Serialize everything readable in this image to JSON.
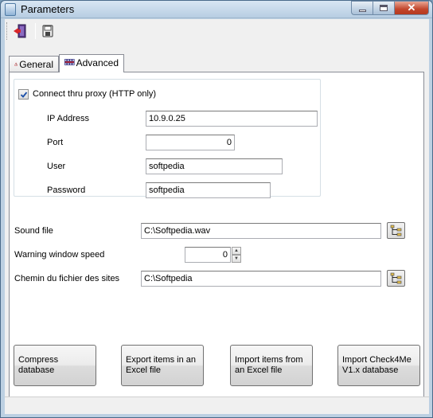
{
  "window": {
    "title": "Parameters",
    "close_glyph": "✕"
  },
  "toolbar": {
    "items": [
      {
        "icon": "exit-door-icon"
      },
      {
        "icon": "save-disk-icon"
      }
    ]
  },
  "tabs": [
    {
      "label": "General",
      "icon": "warning-icon",
      "active": false
    },
    {
      "label": "Advanced",
      "icon": "film-strip-icon",
      "active": true
    }
  ],
  "proxy": {
    "checkbox_label": "Connect thru proxy (HTTP only)",
    "checked": true,
    "ip_label": "IP Address",
    "ip_value": "10.9.0.25",
    "port_label": "Port",
    "port_value": "0",
    "user_label": "User",
    "user_value": "softpedia",
    "password_label": "Password",
    "password_value": "softpedia"
  },
  "sound": {
    "label": "Sound file",
    "value": "C:\\Softpedia.wav"
  },
  "warning_speed": {
    "label": "Warning window speed",
    "value": "0"
  },
  "sites_path": {
    "label": "Chemin du fichier des sites",
    "value": "C:\\Softpedia"
  },
  "actions": [
    {
      "label": "Compress database"
    },
    {
      "label": "Export items in an Excel file"
    },
    {
      "label": "Import items from an Excel file"
    },
    {
      "label": "Import Check4Me V1.x database"
    }
  ],
  "colors": {
    "window_frame": "#bcd0e2",
    "close_button": "#c2452b",
    "client_bg": "#f0f0f0"
  }
}
